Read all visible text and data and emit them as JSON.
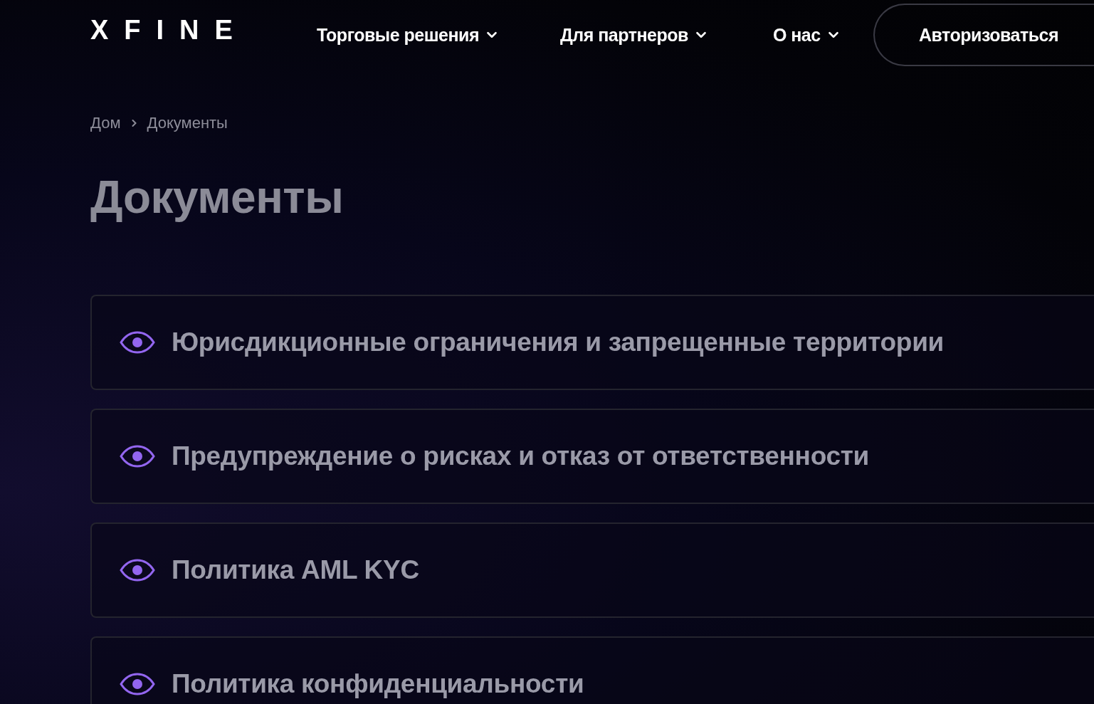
{
  "header": {
    "logo": "XFINE",
    "nav": [
      {
        "label": "Торговые решения",
        "has_dropdown": true
      },
      {
        "label": "Для партнеров",
        "has_dropdown": true
      },
      {
        "label": "О нас",
        "has_dropdown": true
      }
    ],
    "login_button": "Авторизоваться"
  },
  "breadcrumbs": [
    "Дом",
    "Документы"
  ],
  "title": "Документы",
  "documents": [
    {
      "title": "Юрисдикционные ограничения и запрещенные территории"
    },
    {
      "title": "Предупреждение о рисках и отказ от ответственности"
    },
    {
      "title": "Политика AML KYC"
    },
    {
      "title": "Политика конфиденциальности"
    }
  ]
}
